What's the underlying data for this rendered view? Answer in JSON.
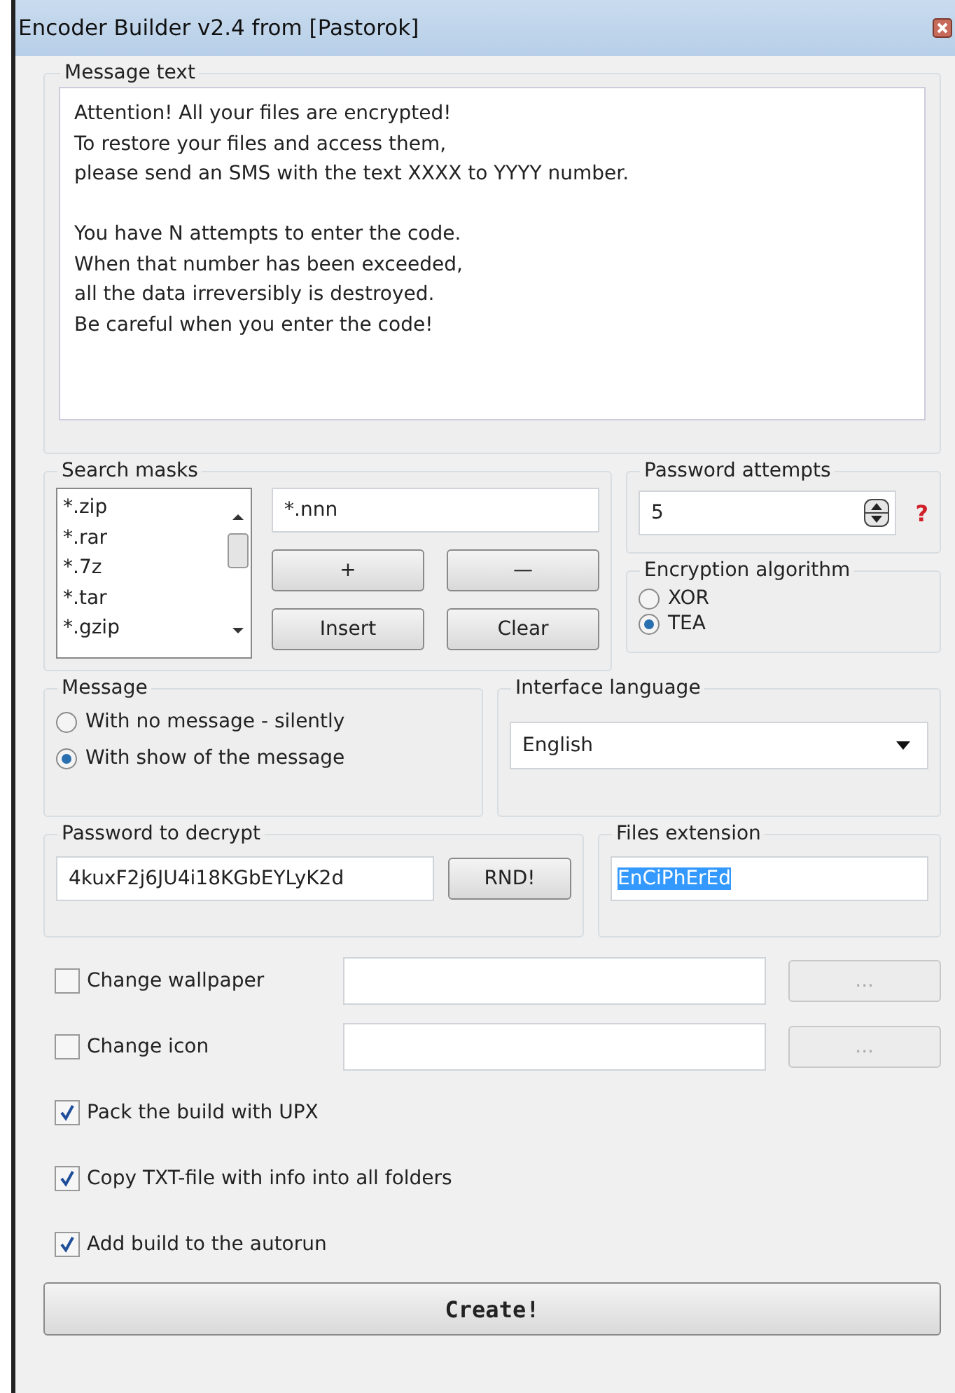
{
  "window": {
    "title": "Encoder Builder v2.4 from [Pastorok]"
  },
  "message_text": {
    "label": "Message text",
    "paragraphs": [
      [
        "Attention! All your files are encrypted!",
        "To restore your files and access them,",
        "please send an SMS with the text XXXX to YYYY number."
      ],
      [
        "You have N attempts to enter the code.",
        "When that number has been exceeded,",
        "all the data irreversibly is destroyed.",
        "Be careful when you enter the code!"
      ]
    ]
  },
  "search_masks": {
    "label": "Search masks",
    "items": [
      "*.zip",
      "*.rar",
      "*.7z",
      "*.tar",
      "*.gzip"
    ],
    "mask_value": "*.nnn",
    "buttons": [
      "+",
      "—",
      "Insert",
      "Clear"
    ]
  },
  "password_attempts": {
    "label": "Password attempts",
    "value": "5",
    "help": "?"
  },
  "encryption_algorithm": {
    "label": "Encryption algorithm",
    "options": [
      {
        "label": "XOR",
        "selected": false
      },
      {
        "label": "TEA",
        "selected": true
      }
    ]
  },
  "message": {
    "label": "Message",
    "options": [
      {
        "label": "With no message - silently",
        "selected": false
      },
      {
        "label": "With show of the message",
        "selected": true
      }
    ]
  },
  "interface_language": {
    "label": "Interface language",
    "value": "English"
  },
  "password_to_decrypt": {
    "label": "Password to decrypt",
    "value": "4kuxF2j6JU4i18KGbEYLyK2d",
    "button": "RND!"
  },
  "files_extension": {
    "label": "Files extension",
    "value": "EnCiPhErEd",
    "highlighted": true
  },
  "options": [
    {
      "kind": "file",
      "label": "Change wallpaper",
      "checked": false,
      "browse": "..."
    },
    {
      "kind": "file",
      "label": "Change icon",
      "checked": false,
      "browse": "..."
    },
    {
      "kind": "plain",
      "label": "Pack the build with UPX",
      "checked": true
    },
    {
      "kind": "plain",
      "label": "Copy TXT-file with info into all folders",
      "checked": true
    },
    {
      "kind": "plain",
      "label": "Add build to the autorun",
      "checked": true
    }
  ],
  "create_button": "Create!"
}
